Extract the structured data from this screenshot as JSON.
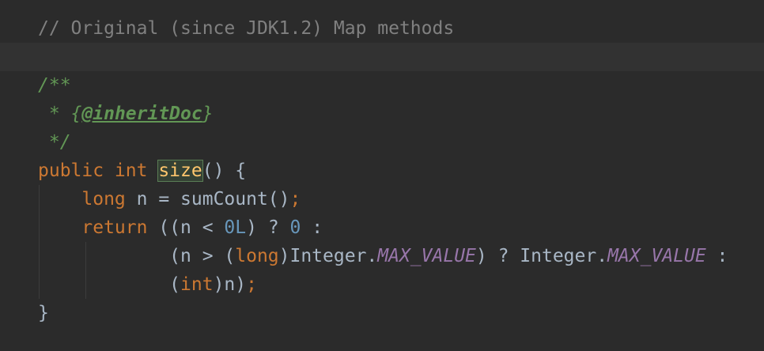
{
  "editor": {
    "lines": [
      {
        "parts": [
          {
            "t": "// Original (since JDK1.2) Map methods",
            "c": "comment"
          }
        ]
      },
      {
        "parts": [],
        "current": true
      },
      {
        "parts": [
          {
            "t": "/**",
            "c": "doc"
          }
        ]
      },
      {
        "parts": [
          {
            "t": " * ",
            "c": "doc"
          },
          {
            "t": "{",
            "c": "doc"
          },
          {
            "t": "@inheritDoc",
            "c": "doc-tag"
          },
          {
            "t": "}",
            "c": "doc"
          }
        ]
      },
      {
        "parts": [
          {
            "t": " */",
            "c": "doc"
          }
        ]
      },
      {
        "parts": [
          {
            "t": "public int ",
            "c": "kw"
          },
          {
            "t": "size",
            "c": "hl-size"
          },
          {
            "t": "() {",
            "c": "punc"
          }
        ]
      },
      {
        "parts": [
          {
            "t": "    ",
            "c": "punc"
          },
          {
            "t": "long ",
            "c": "kw"
          },
          {
            "t": "n = sumCount()",
            "c": "punc"
          },
          {
            "t": ";",
            "c": "semi"
          }
        ]
      },
      {
        "parts": [
          {
            "t": "    ",
            "c": "punc"
          },
          {
            "t": "return ",
            "c": "kw"
          },
          {
            "t": "((n < ",
            "c": "punc"
          },
          {
            "t": "0L",
            "c": "num"
          },
          {
            "t": ") ? ",
            "c": "punc"
          },
          {
            "t": "0",
            "c": "num"
          },
          {
            "t": " :",
            "c": "punc"
          }
        ]
      },
      {
        "parts": [
          {
            "t": "            (n > (",
            "c": "punc"
          },
          {
            "t": "long",
            "c": "kw"
          },
          {
            "t": ")Integer.",
            "c": "punc"
          },
          {
            "t": "MAX_VALUE",
            "c": "const"
          },
          {
            "t": ") ? Integer.",
            "c": "punc"
          },
          {
            "t": "MAX_VALUE",
            "c": "const"
          },
          {
            "t": " :",
            "c": "punc"
          }
        ]
      },
      {
        "parts": [
          {
            "t": "            (",
            "c": "punc"
          },
          {
            "t": "int",
            "c": "kw"
          },
          {
            "t": ")n)",
            "c": "punc"
          },
          {
            "t": ";",
            "c": "semi"
          }
        ]
      },
      {
        "parts": [
          {
            "t": "}",
            "c": "punc"
          }
        ]
      }
    ]
  }
}
